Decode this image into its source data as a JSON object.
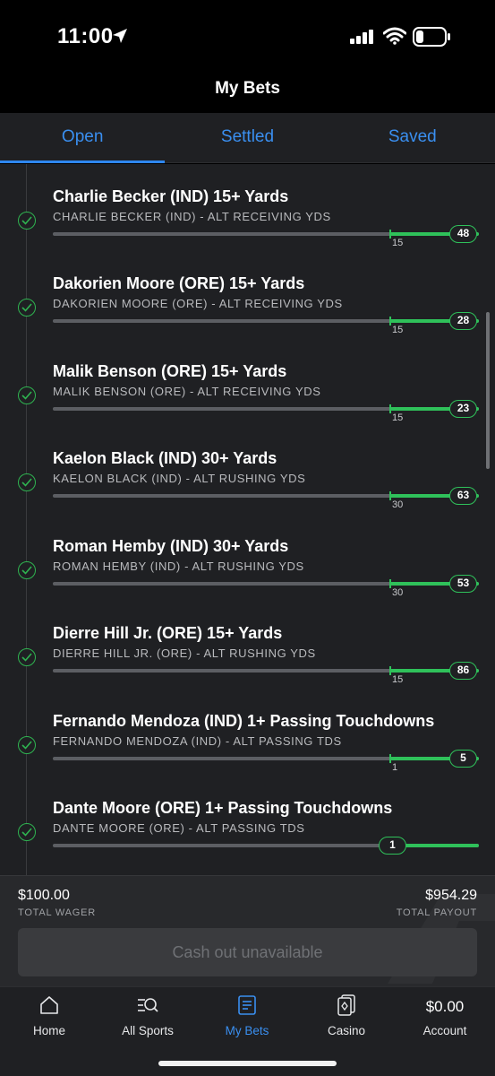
{
  "status_bar": {
    "time": "11:00"
  },
  "header": {
    "title": "My Bets"
  },
  "tabs": [
    {
      "label": "Open",
      "active": true
    },
    {
      "label": "Settled",
      "active": false
    },
    {
      "label": "Saved",
      "active": false
    }
  ],
  "legs": [
    {
      "title": "Charlie Becker (IND) 15+ Yards",
      "subtitle": "CHARLIE BECKER (IND) - ALT RECEIVING YDS",
      "threshold": "15",
      "value": "48",
      "progress_fraction": 1.0
    },
    {
      "title": "Dakorien Moore (ORE) 15+ Yards",
      "subtitle": "DAKORIEN MOORE (ORE) - ALT RECEIVING YDS",
      "threshold": "15",
      "value": "28",
      "progress_fraction": 1.0
    },
    {
      "title": "Malik Benson (ORE) 15+ Yards",
      "subtitle": "MALIK BENSON (ORE) - ALT RECEIVING YDS",
      "threshold": "15",
      "value": "23",
      "progress_fraction": 1.0
    },
    {
      "title": "Kaelon Black (IND) 30+ Yards",
      "subtitle": "KAELON BLACK (IND) - ALT RUSHING YDS",
      "threshold": "30",
      "value": "63",
      "progress_fraction": 1.0
    },
    {
      "title": "Roman Hemby (IND) 30+ Yards",
      "subtitle": "ROMAN HEMBY (IND) - ALT RUSHING YDS",
      "threshold": "30",
      "value": "53",
      "progress_fraction": 1.0
    },
    {
      "title": "Dierre Hill Jr. (ORE) 15+ Yards",
      "subtitle": "DIERRE HILL JR. (ORE) - ALT RUSHING YDS",
      "threshold": "15",
      "value": "86",
      "progress_fraction": 1.0
    },
    {
      "title": "Fernando Mendoza (IND) 1+ Passing Touchdowns",
      "subtitle": "FERNANDO MENDOZA (IND) - ALT PASSING TDS",
      "threshold": "1",
      "value": "5",
      "progress_fraction": 1.0
    },
    {
      "title": "Dante Moore (ORE) 1+ Passing Touchdowns",
      "subtitle": "DANTE MOORE (ORE) - ALT PASSING TDS",
      "threshold": "",
      "value": "1",
      "progress_fraction": 1.0
    }
  ],
  "summary": {
    "total_wager": "$100.00",
    "total_wager_label": "TOTAL WAGER",
    "total_payout": "$954.29",
    "total_payout_label": "TOTAL PAYOUT",
    "cashout_label": "Cash out unavailable"
  },
  "nav": {
    "home": "Home",
    "all_sports": "All Sports",
    "my_bets": "My Bets",
    "casino": "Casino",
    "account_balance": "$0.00",
    "account": "Account"
  },
  "colors": {
    "accent_blue": "#2e86f0",
    "success_green": "#2fc15a",
    "background": "#1f2023"
  }
}
